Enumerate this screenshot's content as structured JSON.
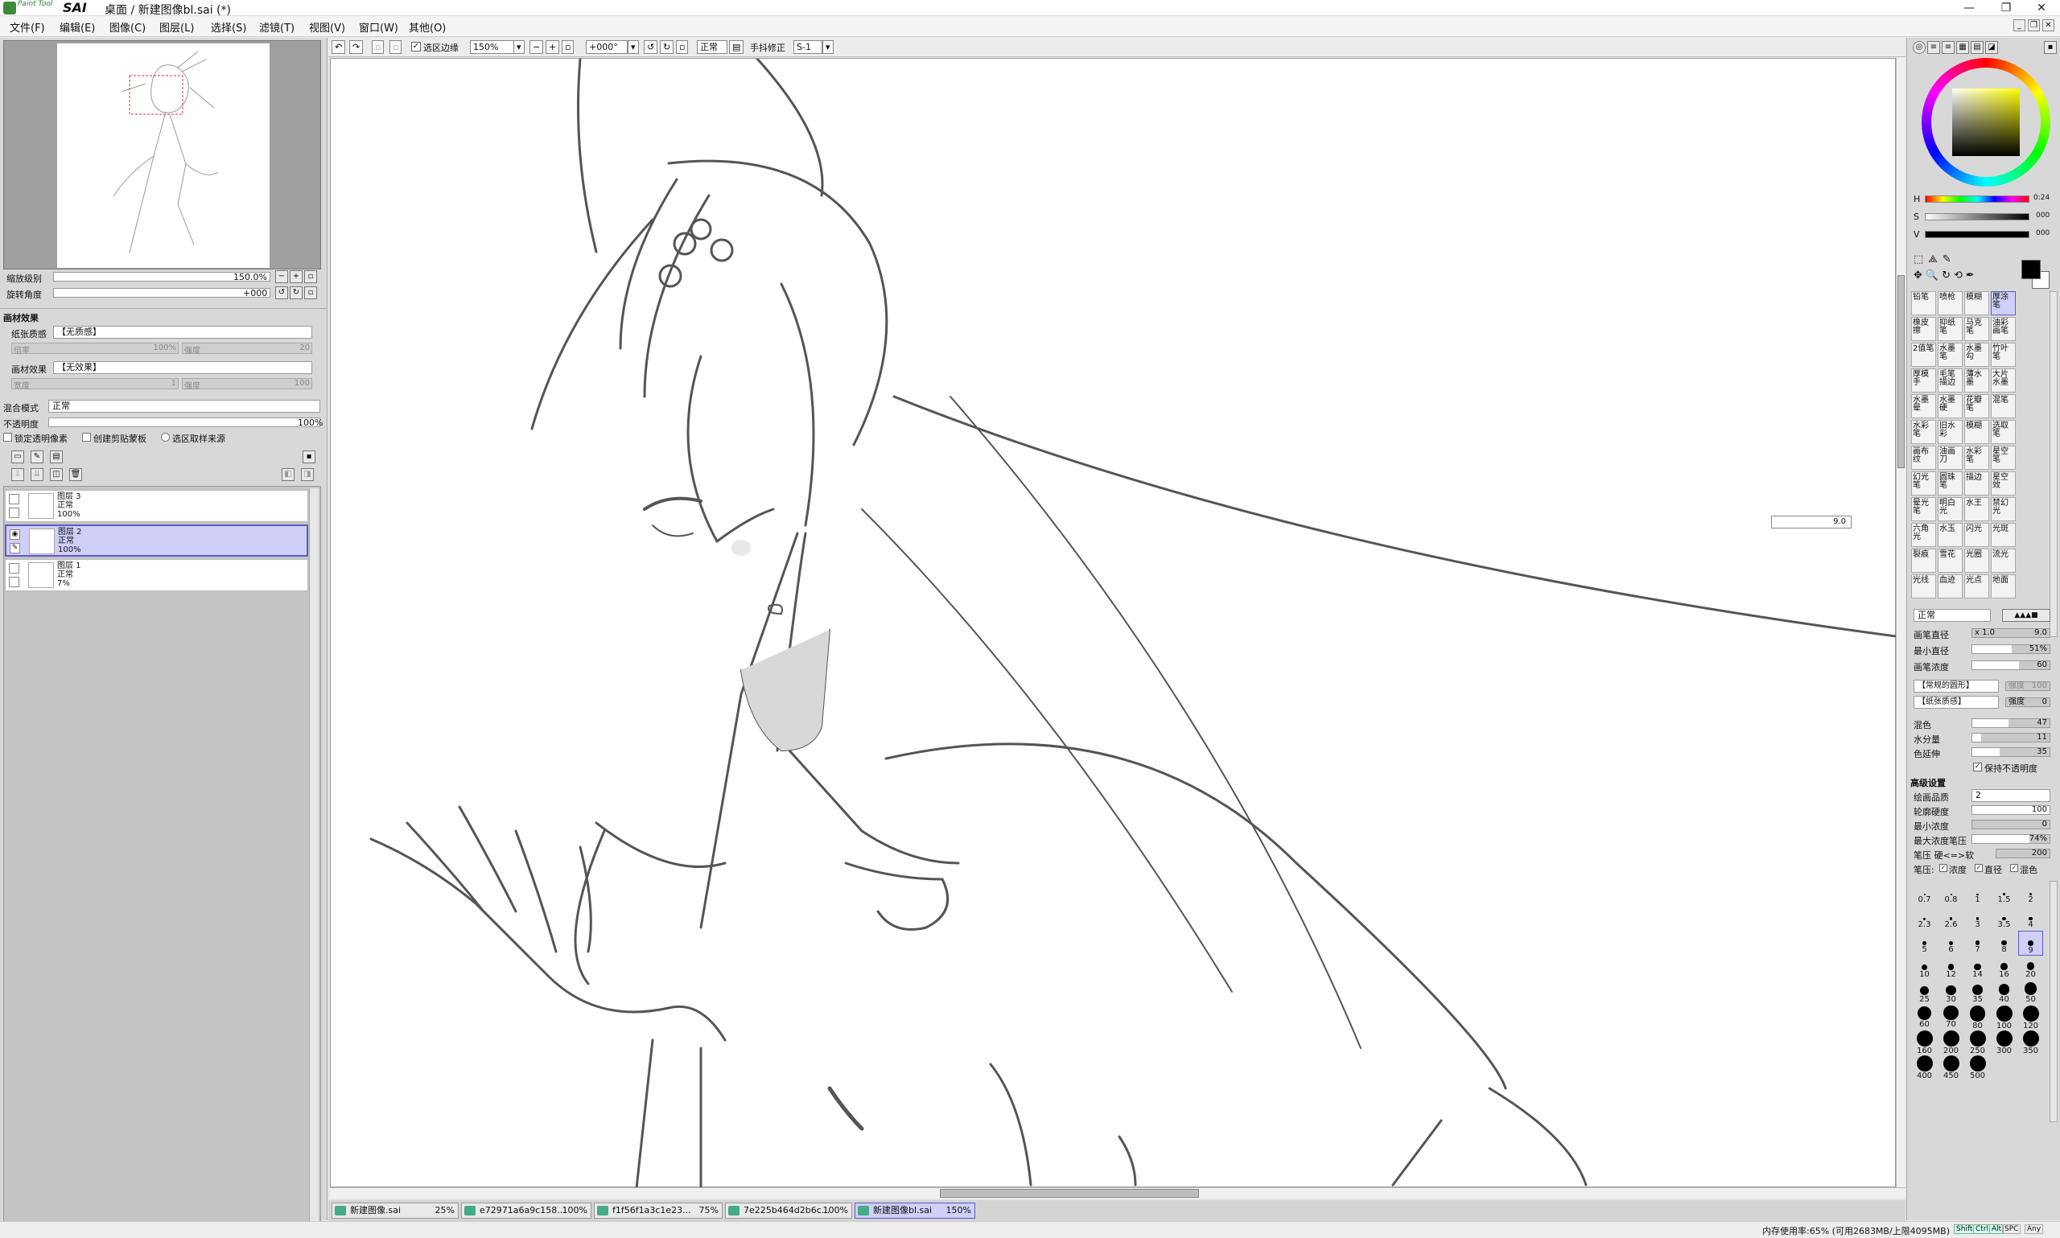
{
  "window": {
    "brand_small": "Paint Tool",
    "brand": "SAI",
    "title": "桌面 / 新建图像bl.sai (*)",
    "minimize": "—",
    "maximize": "❐",
    "close": "✕"
  },
  "menu": [
    "文件(F)",
    "编辑(E)",
    "图像(C)",
    "图层(L)",
    "选择(S)",
    "滤镜(T)",
    "视图(V)",
    "窗口(W)",
    "其他(O)"
  ],
  "navigator": {
    "zoom_label": "缩放级别",
    "zoom_value": "150.0%",
    "rotate_label": "旋转角度",
    "rotate_value": "+000"
  },
  "canvas_effects": {
    "header": "画材效果",
    "paper_label": "纸张质感",
    "paper_value": "【无质感】",
    "paper_scale_label": "倍率",
    "paper_scale_value": "100%",
    "paper_strength_label": "强度",
    "paper_strength_value": "20",
    "effect_label": "画材效果",
    "effect_value": "【无效果】",
    "effect_width_label": "宽度",
    "effect_width_value": "1",
    "effect_strength_label": "强度",
    "effect_strength_value": "100"
  },
  "layer_props": {
    "blend_label": "混合模式",
    "blend_value": "正常",
    "opacity_label": "不透明度",
    "opacity_value": "100%",
    "opacity_fill": 1.0,
    "lock_alpha": "锁定透明像素",
    "clipping": "创建剪贴蒙板",
    "sel_source": "选区取样来源"
  },
  "layers": [
    {
      "name": "图层 3",
      "mode": "正常",
      "opacity": "100%",
      "selected": false
    },
    {
      "name": "图层 2",
      "mode": "正常",
      "opacity": "100%",
      "selected": true
    },
    {
      "name": "图层 1",
      "mode": "正常",
      "opacity": "7%",
      "selected": false
    }
  ],
  "toolbar": {
    "sel_edge": "选区边缘",
    "zoom": "150%",
    "angle": "+000°",
    "mode": "正常",
    "stabilizer_label": "手抖修正",
    "stabilizer_value": "S-1"
  },
  "canvas_size_box": "9.0",
  "tabs": [
    {
      "name": "新建图像.sai",
      "pct": "25%",
      "active": false
    },
    {
      "name": "e72971a6a9c158...",
      "pct": "100%",
      "active": false
    },
    {
      "name": "f1f56f1a3c1e23...",
      "pct": "75%",
      "active": false
    },
    {
      "name": "7e225b464d2b6c...",
      "pct": "100%",
      "active": false
    },
    {
      "name": "新建图像bl.sai",
      "pct": "150%",
      "active": true
    }
  ],
  "status": {
    "memory": "内存使用率:65% (可用2683MB/上限4095MB)",
    "keys": [
      "Shift",
      "Ctrl",
      "Alt",
      "SPC",
      "Any"
    ]
  },
  "color": {
    "h_label": "H",
    "h_value": "0:24",
    "s_label": "S",
    "s_value": "000",
    "v_label": "V",
    "v_value": "000",
    "primary": "#000000",
    "secondary": "#ffffff",
    "accent": "#5b5bc8"
  },
  "brushes": [
    "铅笔",
    "喷枪",
    "模糊",
    "厚涂笔",
    "橡皮擦",
    "抑纸笔",
    "马克笔",
    "油彩画笔",
    "2值笔",
    "水墨笔",
    "水墨勾",
    "竹叶笔",
    "厚模手",
    "毛笔描边",
    "薄水墨",
    "大片水墨",
    "水墨晕",
    "水墨硬",
    "花瓣笔",
    "混笔",
    "水彩笔",
    "旧水彩",
    "模糊",
    "选取笔",
    "画布纹",
    "油画刀",
    "水彩笔",
    "星空笔",
    "幻光笔",
    "圆珠笔",
    "描边",
    "星空效",
    "晕光笔",
    "明白光",
    "水王",
    "禁幻光",
    "六角光",
    "水玉",
    "闪光",
    "光斑",
    "裂痕",
    "雪花",
    "光圈",
    "流光",
    "光线",
    "血迹",
    "光点",
    "地面"
  ],
  "brush_settings": {
    "mode": "正常",
    "size_label": "画笔直径",
    "size_mult": "x 1.0",
    "size_value": "9.0",
    "min_size_label": "最小直径",
    "min_size_value": "51%",
    "min_size_fill": 0.51,
    "density_label": "画笔浓度",
    "density_value": "60",
    "density_fill": 0.6,
    "shape_value": "【常规的圆形】",
    "shape_strength_label": "强度",
    "shape_strength_value": "100",
    "texture_value": "【纸张质感】",
    "texture_strength_label": "强度",
    "texture_strength_value": "0",
    "blend_label": "混色",
    "blend_value": "47",
    "blend_fill": 0.47,
    "water_label": "水分量",
    "water_value": "11",
    "water_fill": 0.11,
    "stretch_label": "色延伸",
    "stretch_value": "35",
    "stretch_fill": 0.35,
    "keep_opacity": "保持不透明度",
    "advanced_header": "高级设置",
    "quality_label": "绘画品质",
    "quality_value": "2",
    "edge_label": "轮廓硬度",
    "edge_value": "100",
    "edge_fill": 1.0,
    "min_density_label": "最小浓度",
    "min_density_value": "0",
    "min_density_fill": 0.0,
    "max_pressure_label": "最大浓度笔压",
    "max_pressure_value": "74%",
    "max_pressure_fill": 0.74,
    "pressure_label": "笔压 硬<=>软",
    "pressure_value": "200",
    "pressure2_label": "笔压:",
    "opt_density": "浓度",
    "opt_size": "直径",
    "opt_blend": "混色"
  },
  "brush_sizes": [
    "0.7",
    "0.8",
    "1",
    "1.5",
    "2",
    "2.3",
    "2.6",
    "3",
    "3.5",
    "4",
    "5",
    "6",
    "7",
    "8",
    "9",
    "10",
    "12",
    "14",
    "16",
    "20",
    "25",
    "30",
    "35",
    "40",
    "50",
    "60",
    "70",
    "80",
    "100",
    "120",
    "160",
    "200",
    "250",
    "300",
    "350",
    "400",
    "450",
    "500"
  ],
  "selected_size": "9"
}
